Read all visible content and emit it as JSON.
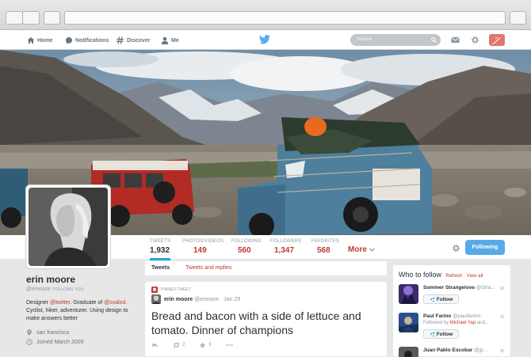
{
  "nav": {
    "home": "Home",
    "notifications": "Notifications",
    "discover": "Discover",
    "me": "Me",
    "search_placeholder": "Search"
  },
  "stats": [
    {
      "label": "TWEETS",
      "value": "1,932"
    },
    {
      "label": "PHOTOS/VIDEOS",
      "value": "149"
    },
    {
      "label": "FOLLOWING",
      "value": "560"
    },
    {
      "label": "FOLLOWERS",
      "value": "1,347"
    },
    {
      "label": "FAVORITES",
      "value": "568"
    }
  ],
  "more_label": "More",
  "following_button": "Following",
  "profile": {
    "name": "erin moore",
    "handle": "@emoore",
    "follows_you": "FOLLOWS YOU",
    "bio_1": "Designer ",
    "bio_link1": "@twitter",
    "bio_2": ". Graduate of ",
    "bio_link2": "@svalxd",
    "bio_3": ". Cyclist, hiker, adventurer. Using design to make answers better",
    "location": "san francisco",
    "joined": "Joined March 2009"
  },
  "tabs": {
    "tweets": "Tweets",
    "replies": "Tweets and replies"
  },
  "tweet": {
    "pinned_label": "PINNED TWEET",
    "name": "erin moore",
    "handle": "@emoore",
    "date": "· Jan 29",
    "text": "Bread and bacon with a side of lettuce and tomato. Dinner of champions",
    "retweets": "2",
    "favorites": "5"
  },
  "who_to_follow": {
    "title": "Who to follow",
    "refresh": "Refresh",
    "view_all": "View all",
    "sep1": " · ",
    "sep2": " · ",
    "follow_label": "Follow",
    "users": [
      {
        "name": "Sommer Strangelove",
        "handle": "@Stra...",
        "note": ""
      },
      {
        "name": "Paul Farino",
        "handle": "@paulfarino",
        "note": "Followed by ",
        "note_link": "Michael Yap",
        "note_suffix": " and..."
      },
      {
        "name": "Juan Pablo Escobar",
        "handle": "@jp...",
        "note": ""
      }
    ]
  },
  "colors": {
    "accent": "#c0392b",
    "blue": "#1da1f2",
    "follow_btn": "#58a9e8",
    "compose": "#e0766e"
  }
}
